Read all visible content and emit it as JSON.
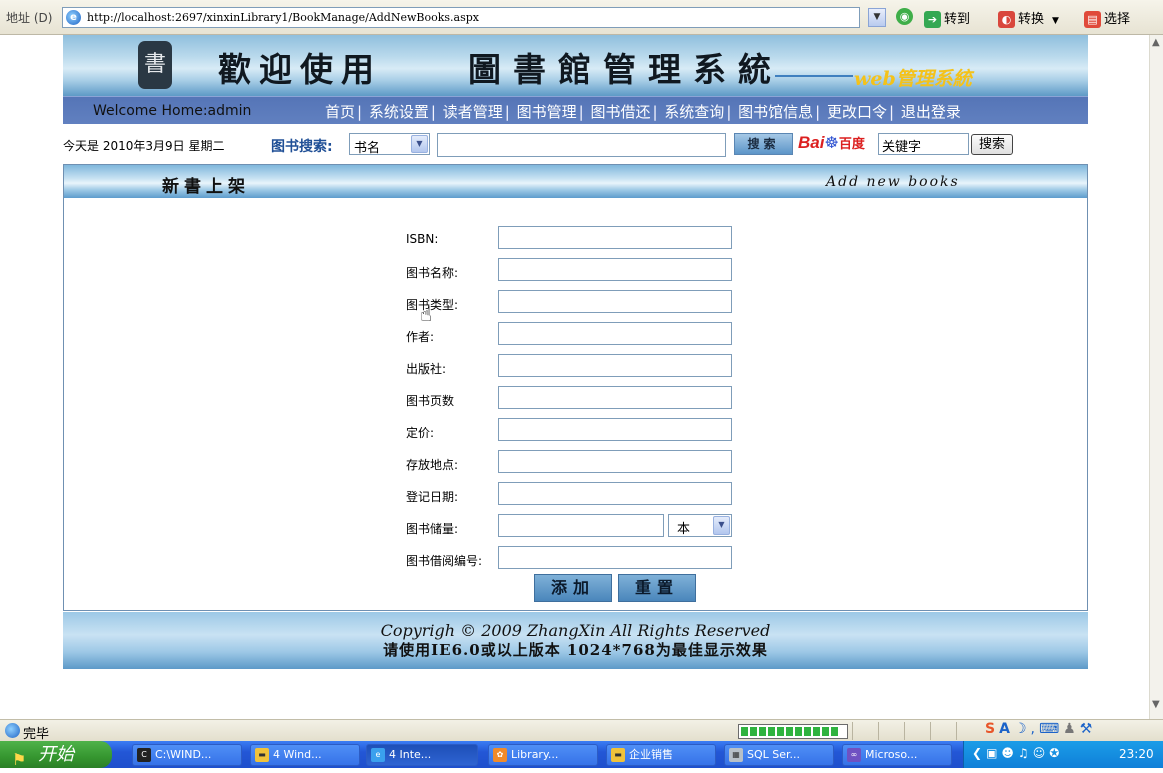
{
  "browser": {
    "address_label": "地址 (D)",
    "url": "http://localhost:2697/xinxinLibrary1/BookManage/AddNewBooks.aspx",
    "goto_label": "转到",
    "convert_label": "转换",
    "select_label": "选择",
    "status_text": "完毕",
    "progress_fraction": 0.95
  },
  "banner": {
    "title_part1": "歡迎使用",
    "title_part2": "圖書館管理系統",
    "subtitle": "web管理系統",
    "logo_char": "書"
  },
  "nav": {
    "welcome": "Welcome Home:admin",
    "items": [
      "首页",
      "系统设置",
      "读者管理",
      "图书管理",
      "图书借还",
      "系统查询",
      "图书馆信息",
      "更改口令",
      "退出登录"
    ]
  },
  "search": {
    "date_text": "今天是 2010年3月9日 星期二",
    "label": "图书搜索:",
    "field_selected": "书名",
    "search_button": "搜索",
    "baidu_input_value": "关键字",
    "baidu_button": "搜索"
  },
  "section": {
    "title_cn": "新書上架",
    "title_en": "Add new books"
  },
  "form": {
    "fields": [
      {
        "label": "ISBN:",
        "value": ""
      },
      {
        "label": "图书名称:",
        "value": ""
      },
      {
        "label": "图书类型:",
        "value": ""
      },
      {
        "label": "作者:",
        "value": ""
      },
      {
        "label": "出版社:",
        "value": ""
      },
      {
        "label": "图书页数",
        "value": ""
      },
      {
        "label": "定价:",
        "value": ""
      },
      {
        "label": "存放地点:",
        "value": ""
      },
      {
        "label": "登记日期:",
        "value": ""
      },
      {
        "label": "图书储量:",
        "value": ""
      },
      {
        "label": "图书借阅编号:",
        "value": ""
      }
    ],
    "unit_selected": "本",
    "add_button": "添加",
    "reset_button": "重置"
  },
  "footer": {
    "copyright": "Copyrigh © 2009 ZhangXin   All Rights Reserved",
    "best_view": "请使用IE6.0或以上版本  1024*768为最佳显示效果"
  },
  "taskbar": {
    "start_label": "开始",
    "tasks": [
      "C:\\WIND...",
      "4 Wind...",
      "4 Inte...",
      "Library...",
      "企业销售",
      "SQL Ser...",
      "Microso..."
    ],
    "clock": "23:20"
  },
  "colors": {
    "nav_bg": "#5575b7",
    "search_label": "#1f4f96",
    "banner_sub": "#f4c21a",
    "taskbar": "#2357d6",
    "start": "#35962f"
  }
}
